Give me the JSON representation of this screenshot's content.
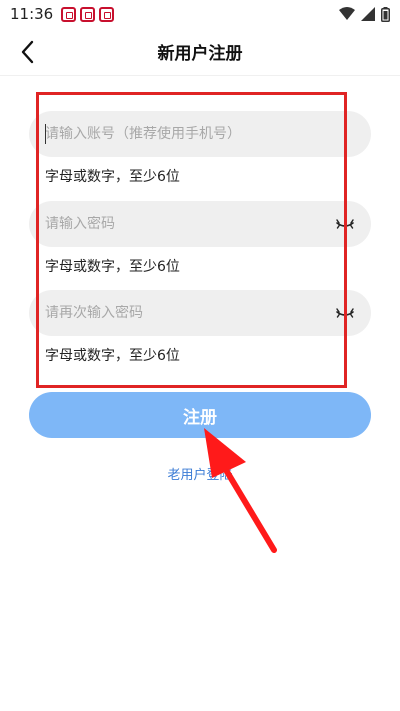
{
  "status_bar": {
    "time": "11:36",
    "notification_icons": [
      "app-notification-icon",
      "app-notification-icon",
      "app-notification-icon"
    ],
    "right_icons": [
      "wifi-icon",
      "signal-icon",
      "battery-icon"
    ]
  },
  "header": {
    "title": "新用户注册",
    "back_icon": "back-arrow-icon"
  },
  "form": {
    "account": {
      "placeholder": "请输入账号（推荐使用手机号）",
      "hint": "字母或数字，至少6位"
    },
    "password": {
      "placeholder": "请输入密码",
      "hint": "字母或数字，至少6位",
      "toggle_icon": "eye-closed-icon"
    },
    "confirm_password": {
      "placeholder": "请再次输入密码",
      "hint": "字母或数字，至少6位",
      "toggle_icon": "eye-closed-icon"
    }
  },
  "register_button": {
    "label": "注册",
    "color": "#7eb7f7"
  },
  "login_link": {
    "label": "老用户登陆"
  },
  "annotation": {
    "highlight_color": "#e02424",
    "arrow_color": "#ff1a1a"
  },
  "colors": {
    "field_background": "#efefef",
    "link": "#3a7bd5"
  }
}
